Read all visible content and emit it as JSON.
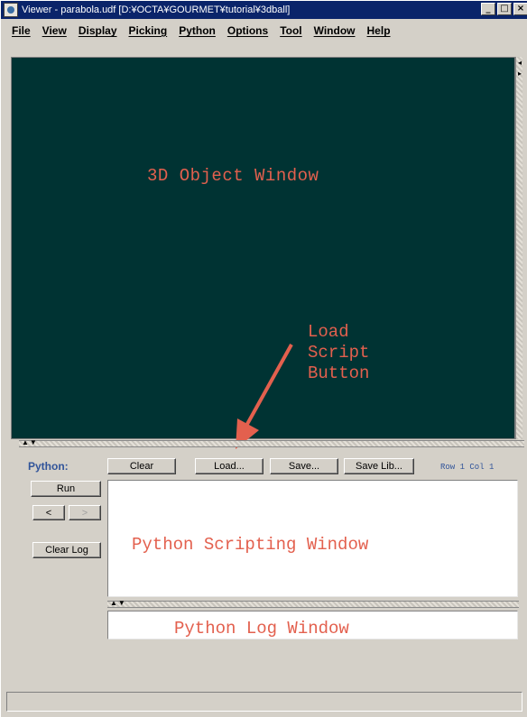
{
  "window": {
    "title": "Viewer - parabola.udf [D:¥OCTA¥GOURMET¥tutorial¥3dball]",
    "minimize": "_",
    "maximize": "□",
    "close": "×"
  },
  "menu": {
    "items": [
      "File",
      "View",
      "Display",
      "Picking",
      "Python",
      "Options",
      "Tool",
      "Window",
      "Help"
    ]
  },
  "viewer": {
    "label": "3D Object Window"
  },
  "annotation": {
    "lines": [
      "Load",
      "Script",
      "Button"
    ],
    "color": "#e3604e"
  },
  "python": {
    "label": "Python:",
    "clear": "Clear",
    "load": "Load...",
    "save": "Save...",
    "save_lib": "Save Lib...",
    "row_col": "Row 1 Col 1",
    "run": "Run",
    "prev": "<",
    "next": ">",
    "clear_log": "Clear Log",
    "script_label": "Python Scripting Window",
    "log_label": "Python Log Window"
  },
  "colors": {
    "viewer_background": "#003333",
    "annotation": "#e3604e",
    "python_label": "#31549a",
    "titlebar": "#0a246a"
  }
}
